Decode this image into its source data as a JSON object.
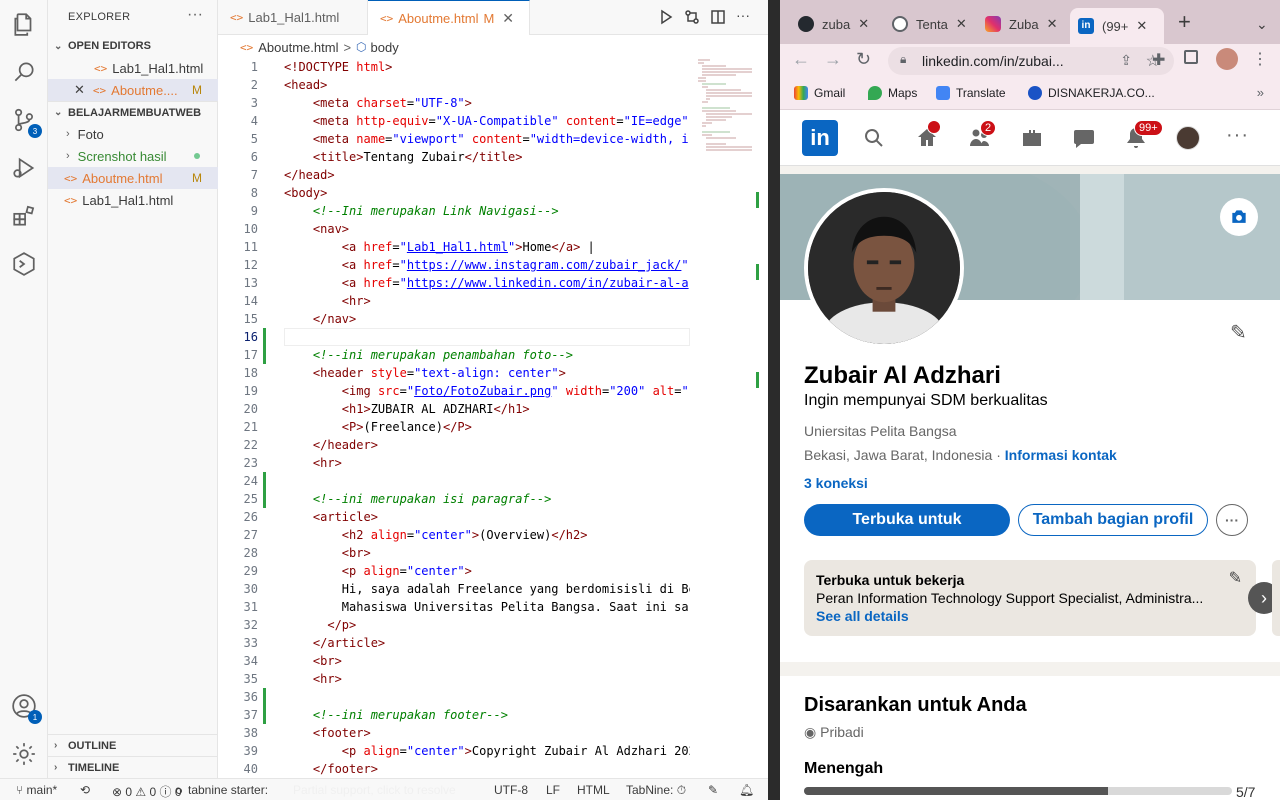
{
  "vscode": {
    "explorer_title": "EXPLORER",
    "open_editors_label": "OPEN EDITORS",
    "open_editors": [
      {
        "name": "Lab1_Hal1.html",
        "status": ""
      },
      {
        "name": "Aboutme....",
        "status": "M"
      }
    ],
    "project_label": "BELAJARMEMBUATWEB",
    "files": [
      {
        "name": "Foto",
        "type": "folder"
      },
      {
        "name": "Screnshot hasil",
        "type": "folder"
      },
      {
        "name": "Aboutme.html",
        "type": "file",
        "status": "M"
      },
      {
        "name": "Lab1_Hal1.html",
        "type": "file",
        "status": ""
      }
    ],
    "outline_label": "OUTLINE",
    "timeline_label": "TIMELINE",
    "tabs": [
      {
        "label": "Lab1_Hal1.html",
        "active": false
      },
      {
        "label": "Aboutme.html",
        "modified": "M",
        "active": true
      }
    ],
    "breadcrumb": {
      "file": "Aboutme.html",
      "sep": ">",
      "symbol": "body"
    },
    "source_control_badge": "3",
    "accounts_badge": "1",
    "status": {
      "branch": "main*",
      "errors": "0",
      "warnings": "0",
      "info": "0",
      "tabnine": "tabnine starter:",
      "partial": "Partial support, click to resolve",
      "encoding": "UTF-8",
      "eol": "LF",
      "language": "HTML",
      "tabnine_short": "TabNine:"
    },
    "current_line": "16"
  },
  "browser": {
    "tabs": [
      {
        "label": "zuba",
        "icon": "github-icon"
      },
      {
        "label": "Tenta",
        "icon": "globe-icon"
      },
      {
        "label": "Zuba",
        "icon": "instagram-icon"
      },
      {
        "label": "(99+",
        "icon": "linkedin-icon",
        "active": true
      }
    ],
    "url": "linkedin.com/in/zubai...",
    "bookmarks": [
      "Gmail",
      "Maps",
      "Translate",
      "DISNAKERJA.CO..."
    ],
    "linkedin": {
      "logo": "in",
      "home_badge": "",
      "network_badge": "2",
      "notif_badge": "99+",
      "name": "Zubair Al Adzhari",
      "headline": "Ingin mempunyai SDM berkualitas",
      "education": "Uniersitas Pelita Bangsa",
      "location": "Bekasi, Jawa Barat, Indonesia",
      "location_sep": "·",
      "contact": "Informasi kontak",
      "connections": "3 koneksi",
      "btn_open": "Terbuka untuk",
      "btn_add": "Tambah bagian profil",
      "open_title": "Terbuka untuk bekerja",
      "open_desc": "Peran Information Technology Support Specialist, Administra...",
      "see_all": "See all details",
      "suggest_title": "Disarankan untuk Anda",
      "suggest_private": "Pribadi",
      "level": "Menengah",
      "progress_text": "5/7",
      "progress": 0.71
    }
  }
}
